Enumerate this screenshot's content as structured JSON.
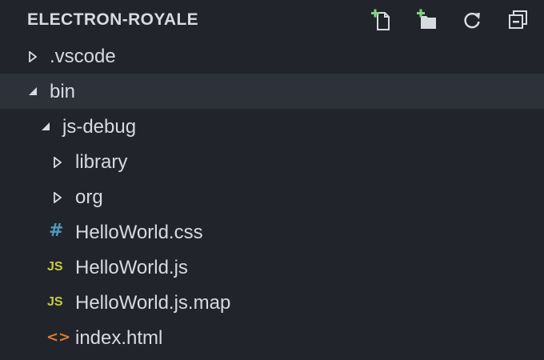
{
  "header": {
    "title": "ELECTRON-ROYALE",
    "actions": [
      {
        "name": "new-file",
        "icon": "new-file-icon"
      },
      {
        "name": "new-folder",
        "icon": "new-folder-icon"
      },
      {
        "name": "refresh",
        "icon": "refresh-icon"
      },
      {
        "name": "collapse-all",
        "icon": "collapse-all-icon"
      }
    ]
  },
  "tree": {
    "items": [
      {
        "label": ".vscode",
        "type": "folder",
        "expanded": false
      },
      {
        "label": "bin",
        "type": "folder",
        "expanded": true,
        "selected": true
      },
      {
        "label": "js-debug",
        "type": "folder",
        "expanded": true
      },
      {
        "label": "library",
        "type": "folder",
        "expanded": false
      },
      {
        "label": "org",
        "type": "folder",
        "expanded": false
      },
      {
        "label": "HelloWorld.css",
        "type": "file",
        "icon": "css-icon",
        "icon_text": "#"
      },
      {
        "label": "HelloWorld.js",
        "type": "file",
        "icon": "js-icon",
        "icon_text": "JS"
      },
      {
        "label": "HelloWorld.js.map",
        "type": "file",
        "icon": "js-icon",
        "icon_text": "JS"
      },
      {
        "label": "index.html",
        "type": "file",
        "icon": "html-icon",
        "icon_text": "<>"
      }
    ]
  },
  "colors": {
    "background": "#21252b",
    "selected_row": "#2c313a",
    "text": "#d7dae0",
    "icon_add": "#7fd47f",
    "css": "#519aba",
    "js": "#cbcb41",
    "html": "#e37933"
  }
}
